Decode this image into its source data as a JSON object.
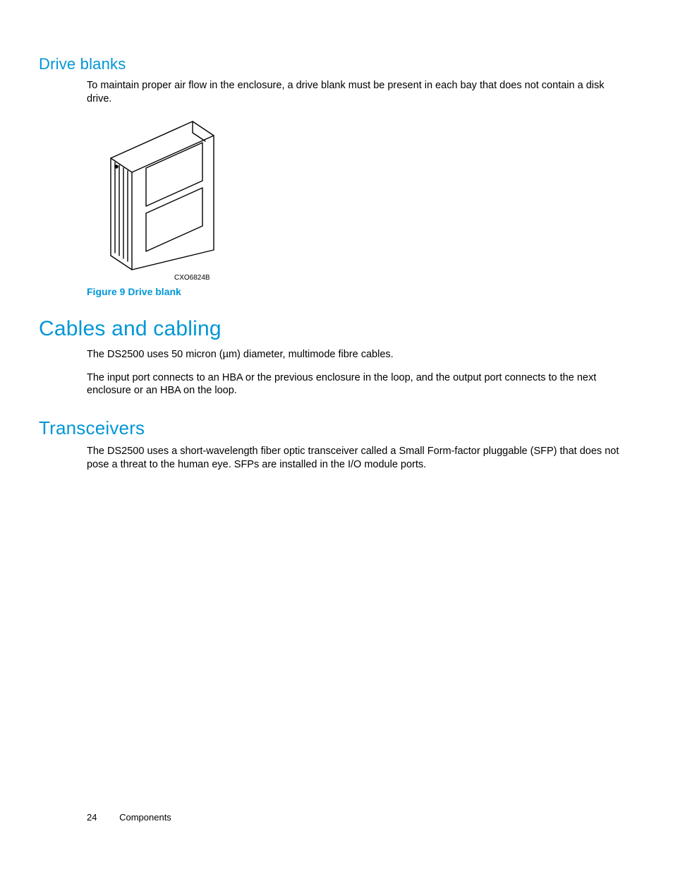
{
  "sections": {
    "drive_blanks": {
      "heading": "Drive blanks",
      "body": "To maintain proper air flow in the enclosure, a drive blank must be present in each bay that does not contain a disk drive.",
      "figure_code": "CXO6824B",
      "figure_label": "Figure 9 Drive blank"
    },
    "cables": {
      "heading": "Cables and cabling",
      "body1": "The DS2500 uses 50 micron (µm) diameter, multimode fibre cables.",
      "body2": "The input port connects to an HBA or the previous enclosure in the loop, and the output port connects to the next enclosure or an HBA on the loop."
    },
    "transceivers": {
      "heading": "Transceivers",
      "body": "The DS2500 uses a short-wavelength fiber optic transceiver called a Small Form-factor pluggable (SFP) that does not pose a threat to the human eye. SFPs are installed in the I/O module ports."
    }
  },
  "footer": {
    "page_number": "24",
    "section_name": "Components"
  }
}
